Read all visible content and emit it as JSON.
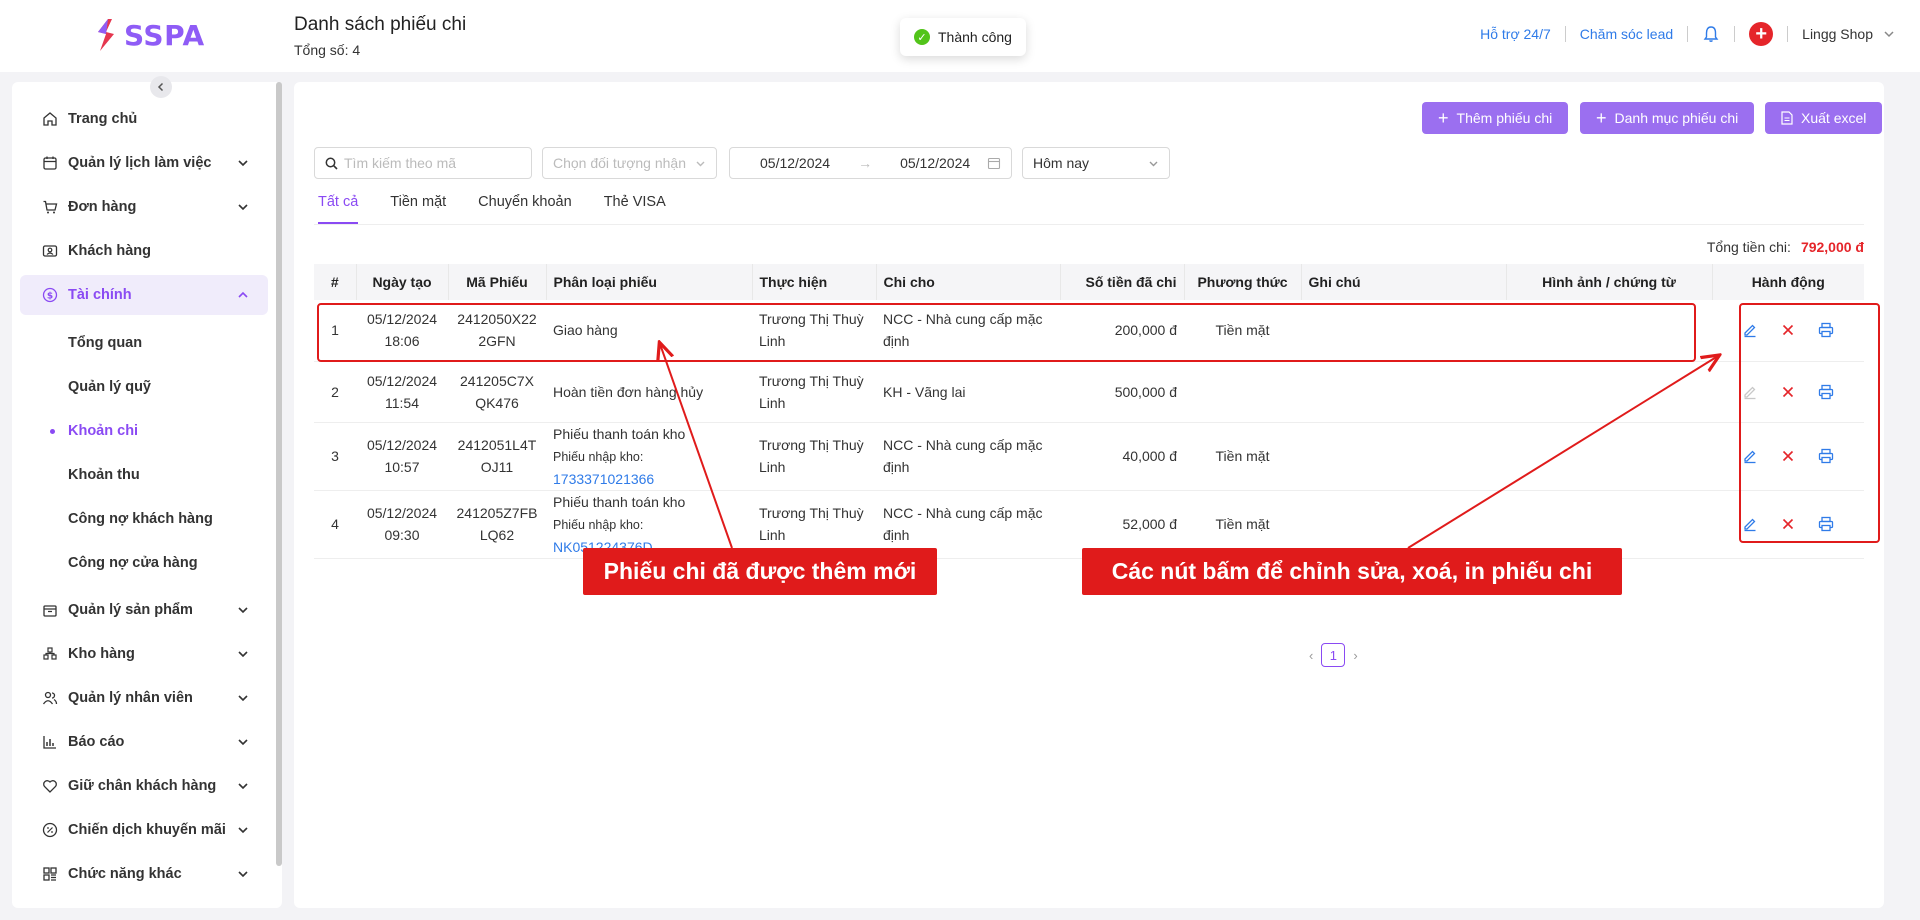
{
  "header": {
    "logo": "SSPA",
    "title": "Danh sách phiếu chi",
    "subtitle": "Tổng số: 4",
    "toast": "Thành công",
    "support": "Hỗ trợ 24/7",
    "lead": "Chăm sóc lead",
    "shop": "Lingg Shop"
  },
  "sidebar": {
    "items": [
      {
        "label": "Trang chủ",
        "icon": "home-icon"
      },
      {
        "label": "Quản lý lịch làm việc",
        "icon": "calendar-icon"
      },
      {
        "label": "Đơn hàng",
        "icon": "cart-icon"
      },
      {
        "label": "Khách hàng",
        "icon": "contact-card-icon"
      },
      {
        "label": "Tài chính",
        "icon": "dollar-circle-icon"
      },
      {
        "label": "Quản lý sản phẩm",
        "icon": "box-icon"
      },
      {
        "label": "Kho hàng",
        "icon": "warehouse-icon"
      },
      {
        "label": "Quản lý nhân viên",
        "icon": "users-icon"
      },
      {
        "label": "Báo cáo",
        "icon": "chart-icon"
      },
      {
        "label": "Giữ chân khách hàng",
        "icon": "heart-icon"
      },
      {
        "label": "Chiến dịch khuyến mãi",
        "icon": "percent-icon"
      },
      {
        "label": "Chức năng khác",
        "icon": "grid-icon"
      }
    ],
    "finance_sub": [
      "Tổng quan",
      "Quản lý quỹ",
      "Khoản chi",
      "Khoản thu",
      "Công nợ khách hàng",
      "Công nợ cửa hàng"
    ]
  },
  "toolbar": {
    "add": "Thêm phiếu chi",
    "category": "Danh mục phiếu chi",
    "export": "Xuất excel"
  },
  "filters": {
    "search_placeholder": "Tìm kiếm theo mã",
    "target_placeholder": "Chọn đối tượng nhận",
    "date_from": "05/12/2024",
    "date_to": "05/12/2024",
    "range": "Hôm nay"
  },
  "tabs": [
    "Tất cả",
    "Tiền mặt",
    "Chuyển khoản",
    "Thẻ VISA"
  ],
  "total_label": "Tổng tiền chi:",
  "total_value": "792,000 đ",
  "table": {
    "columns": [
      "#",
      "Ngày tạo",
      "Mã Phiếu",
      "Phân loại phiếu",
      "Thực hiện",
      "Chi cho",
      "Số tiền đã chi",
      "Phương thức",
      "Ghi chú",
      "Hình ảnh / chứng từ",
      "Hành động"
    ],
    "rows": [
      {
        "no": "1",
        "date": "05/12/2024",
        "time": "18:06",
        "code1": "2412050X22",
        "code2": "2GFN",
        "type": "Giao hàng",
        "sub_label": "",
        "sub_link": "",
        "by1": "Trương Thị Thuỳ",
        "by2": "Linh",
        "to1": "NCC - Nhà cung cấp mặc",
        "to2": "định",
        "amount": "200,000 đ",
        "method": "Tiền mặt",
        "edit_disabled": false
      },
      {
        "no": "2",
        "date": "05/12/2024",
        "time": "11:54",
        "code1": "241205C7X",
        "code2": "QK476",
        "type": "Hoàn tiền đơn hàng hủy",
        "sub_label": "",
        "sub_link": "",
        "by1": "Trương Thị Thuỳ",
        "by2": "Linh",
        "to1": "KH - Vãng lai",
        "to2": "",
        "amount": "500,000 đ",
        "method": "",
        "edit_disabled": true
      },
      {
        "no": "3",
        "date": "05/12/2024",
        "time": "10:57",
        "code1": "2412051L4T",
        "code2": "OJ11",
        "type": "Phiếu thanh toán kho",
        "sub_label": "Phiếu nhập kho:",
        "sub_link": "1733371021366",
        "by1": "Trương Thị Thuỳ",
        "by2": "Linh",
        "to1": "NCC - Nhà cung cấp mặc",
        "to2": "định",
        "amount": "40,000 đ",
        "method": "Tiền mặt",
        "edit_disabled": false
      },
      {
        "no": "4",
        "date": "05/12/2024",
        "time": "09:30",
        "code1": "241205Z7FB",
        "code2": "LQ62",
        "type": "Phiếu thanh toán kho",
        "sub_label": "Phiếu nhập kho:",
        "sub_link": "NK051224376D",
        "by1": "Trương Thị Thuỳ",
        "by2": "Linh",
        "to1": "NCC - Nhà cung cấp mặc",
        "to2": "định",
        "amount": "52,000 đ",
        "method": "Tiền mặt",
        "edit_disabled": false
      }
    ]
  },
  "pager": {
    "current": "1"
  },
  "annotations": {
    "left": "Phiếu chi đã được thêm mới",
    "right": "Các nút bấm để chỉnh sửa, xoá, in phiếu chi"
  },
  "colors": {
    "accent": "#8a4af3",
    "button": "#9b6ff0",
    "danger": "#e5252a",
    "link": "#2f7be8",
    "annotation": "#e01b1b"
  }
}
